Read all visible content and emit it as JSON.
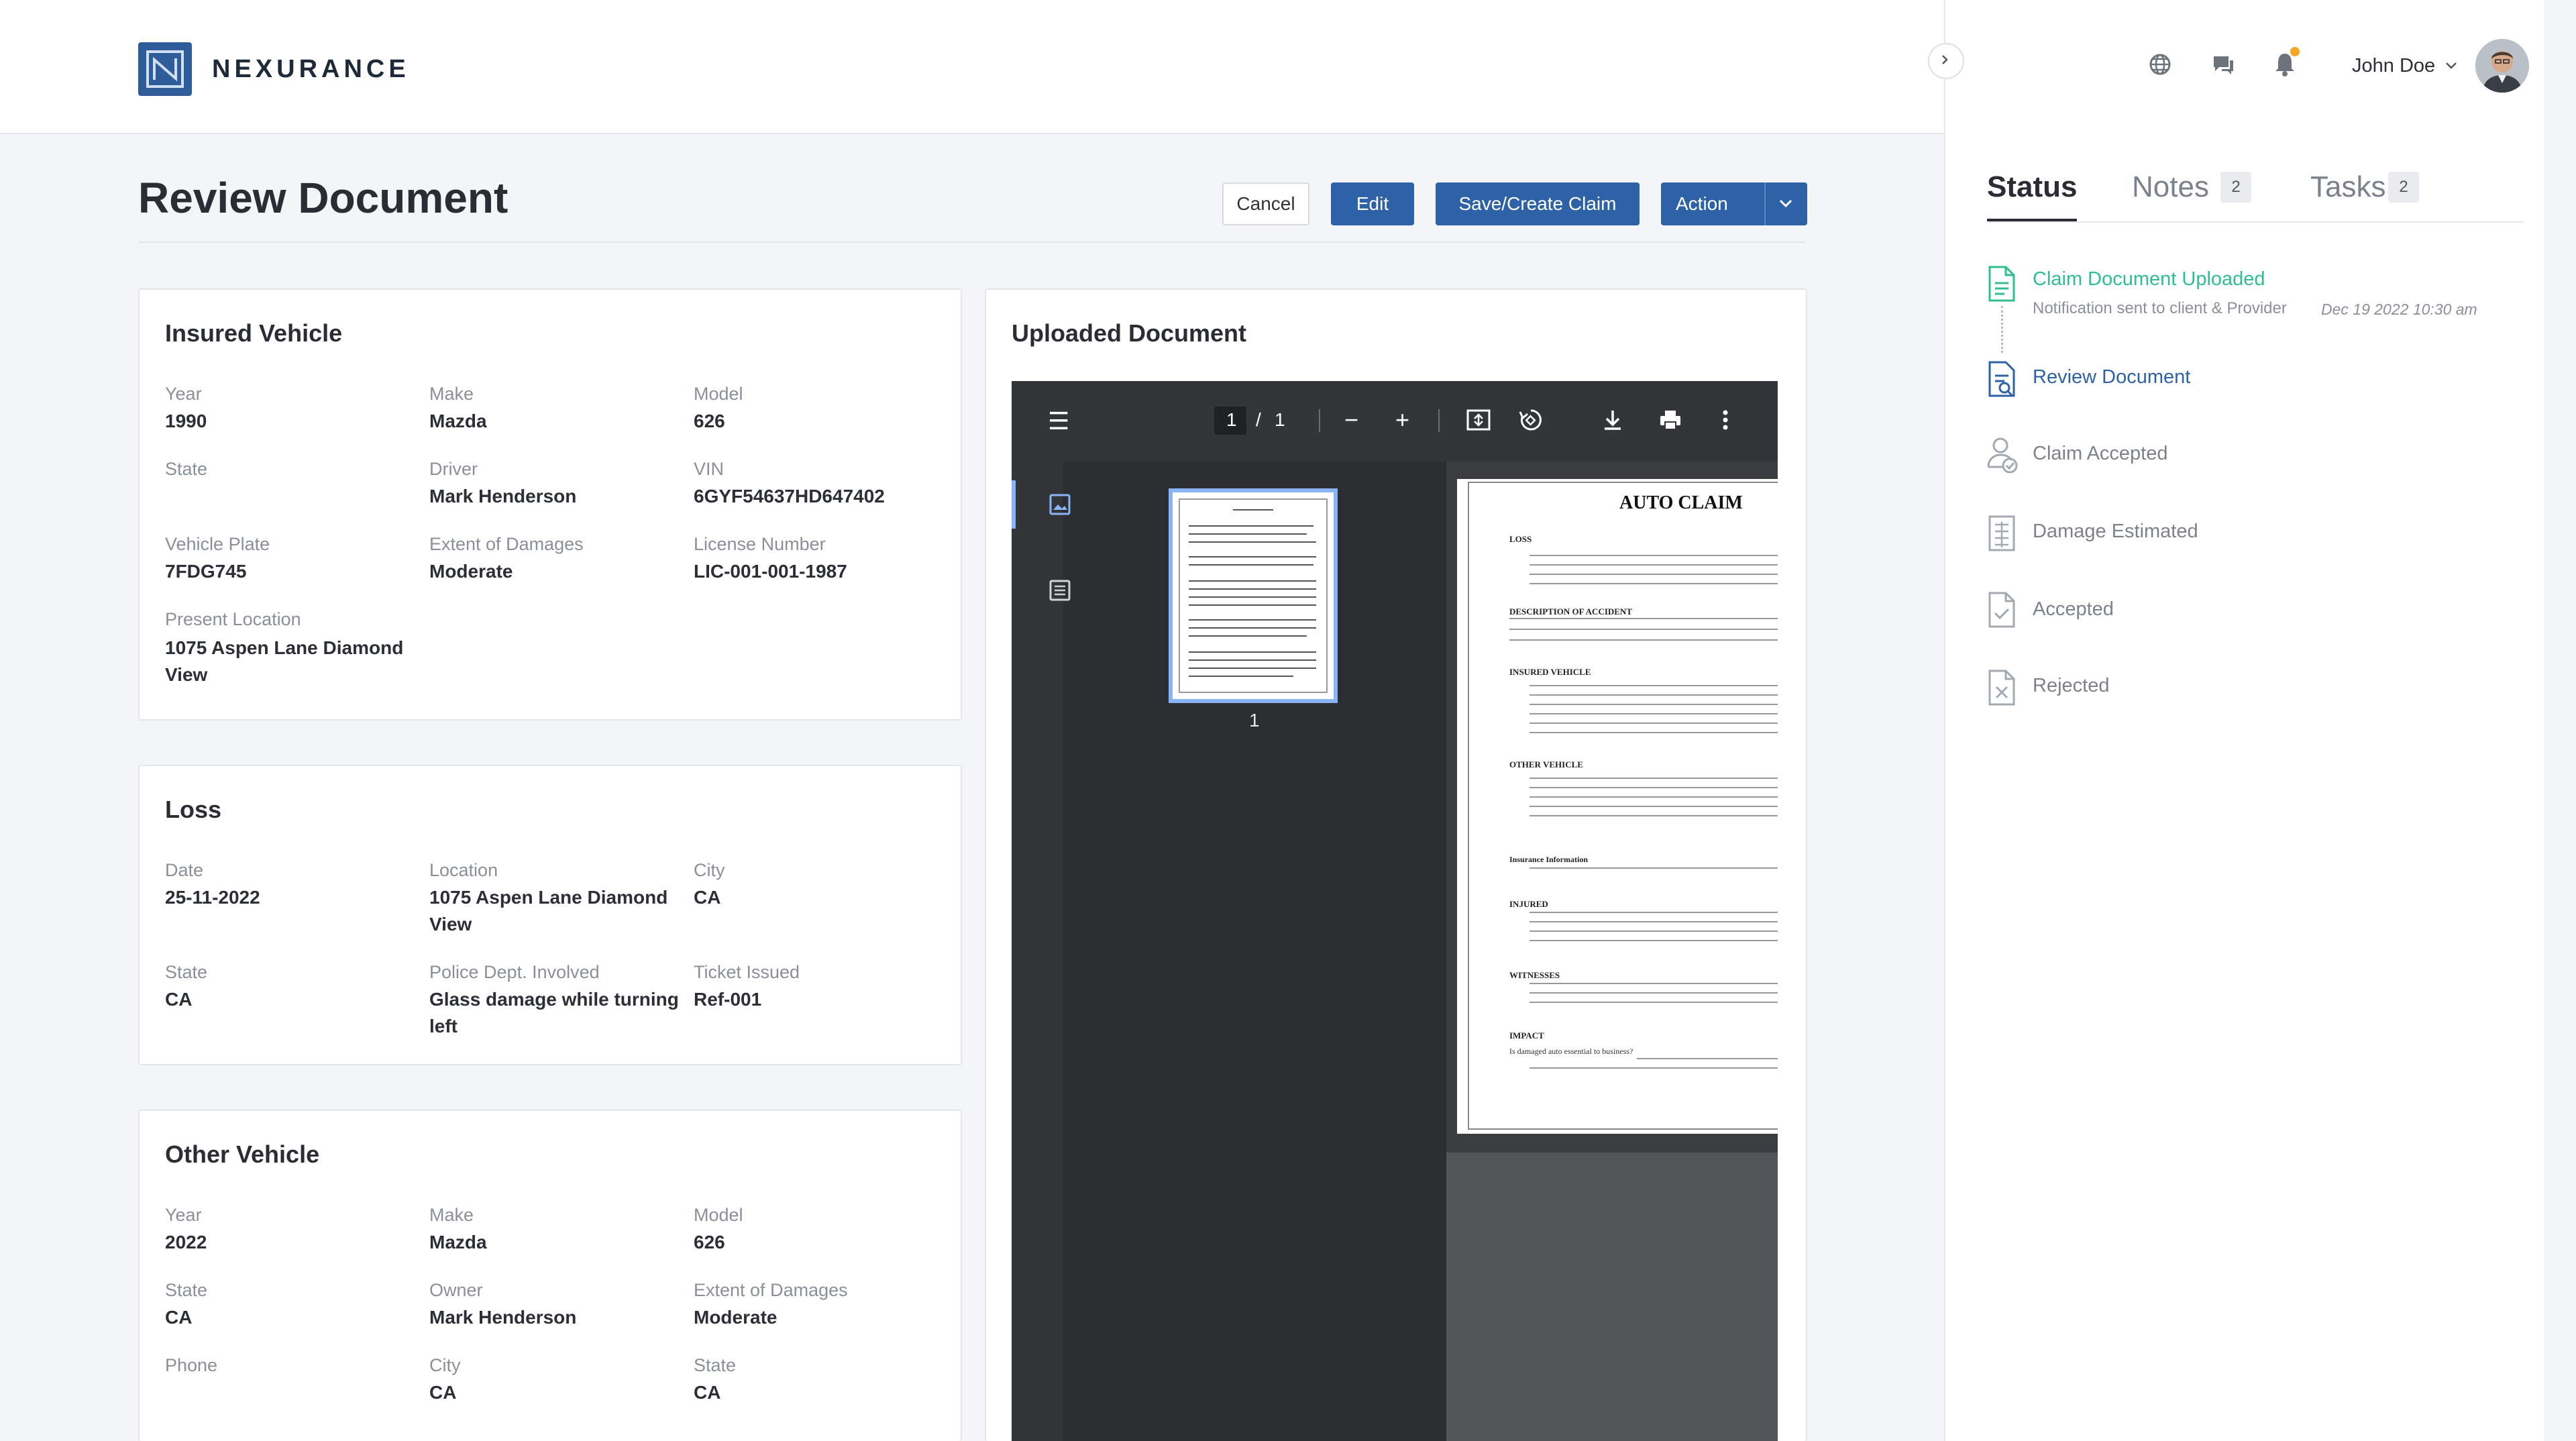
{
  "brand": {
    "name": "NEXURANCE",
    "color": "#2f5d9a"
  },
  "header": {
    "user_name": "John Doe",
    "icons": [
      "globe-icon",
      "chat-icon",
      "bell-icon",
      "chevron-down-icon"
    ],
    "notification_dot_color": "#f5a623"
  },
  "page": {
    "title": "Review Document",
    "buttons": {
      "cancel": "Cancel",
      "edit": "Edit",
      "save": "Save/Create Claim",
      "action": "Action"
    }
  },
  "insured_vehicle": {
    "title": "Insured Vehicle",
    "fields": {
      "year": {
        "label": "Year",
        "value": "1990"
      },
      "make": {
        "label": "Make",
        "value": "Mazda"
      },
      "model": {
        "label": "Model",
        "value": "626"
      },
      "state": {
        "label": "State",
        "value": ""
      },
      "driver": {
        "label": "Driver",
        "value": "Mark Henderson"
      },
      "vin": {
        "label": "VIN",
        "value": "6GYF54637HD647402"
      },
      "plate": {
        "label": "Vehicle Plate",
        "value": "7FDG745"
      },
      "damage": {
        "label": "Extent of Damages",
        "value": "Moderate"
      },
      "license": {
        "label": "License Number",
        "value": "LIC-001-001-1987"
      },
      "location": {
        "label": "Present Location",
        "value_line1": "1075 Aspen Lane Diamond",
        "value_line2": "View"
      }
    }
  },
  "loss": {
    "title": "Loss",
    "fields": {
      "date": {
        "label": "Date",
        "value": "25-11-2022"
      },
      "location": {
        "label": "Location",
        "value_line1": "1075 Aspen Lane Diamond",
        "value_line2": "View"
      },
      "city": {
        "label": "City",
        "value": "CA"
      },
      "state": {
        "label": "State",
        "value": "CA"
      },
      "police": {
        "label": "Police Dept. Involved",
        "value_line1": "Glass damage while turning",
        "value_line2": "left"
      },
      "ticket": {
        "label": "Ticket Issued",
        "value": "Ref-001"
      }
    }
  },
  "other_vehicle": {
    "title": "Other Vehicle",
    "fields": {
      "year": {
        "label": "Year",
        "value": "2022"
      },
      "make": {
        "label": "Make",
        "value": "Mazda"
      },
      "model": {
        "label": "Model",
        "value": "626"
      },
      "state": {
        "label": "State",
        "value": "CA"
      },
      "owner": {
        "label": "Owner",
        "value": "Mark Henderson"
      },
      "damage": {
        "label": "Extent of Damages",
        "value": "Moderate"
      },
      "phone": {
        "label": "Phone",
        "value": ""
      },
      "city": {
        "label": "City",
        "value": "CA"
      },
      "state2": {
        "label": "State",
        "value": "CA"
      }
    }
  },
  "document": {
    "title": "Uploaded Document",
    "viewer": {
      "page_current": "1",
      "page_separator": "/",
      "page_total": "1",
      "thumb_label": "1"
    },
    "pdf": {
      "heading": "AUTO CLAIM",
      "sections": [
        "LOSS",
        "DESCRIPTION OF ACCIDENT",
        "INSURED VEHICLE",
        "OTHER VEHICLE",
        "Insurance Information",
        "INJURED",
        "WITNESSES",
        "IMPACT"
      ],
      "impact_line": "Is damaged auto essential to business?"
    }
  },
  "sidebar": {
    "tabs": [
      {
        "label": "Status"
      },
      {
        "label": "Notes",
        "badge": "2"
      },
      {
        "label": "Tasks",
        "badge": "2"
      }
    ],
    "timeline": [
      {
        "label": "Claim Document Uploaded",
        "detail": "Notification sent to client & Provider",
        "timestamp": "Dec 19 2022 10:30 am",
        "state": "done",
        "color": "#2fbf8f"
      },
      {
        "label": "Review Document",
        "state": "current",
        "color": "#2e62a6"
      },
      {
        "label": "Claim Accepted",
        "state": "pending"
      },
      {
        "label": "Damage Estimated",
        "state": "pending"
      },
      {
        "label": "Accepted",
        "state": "pending"
      },
      {
        "label": "Rejected",
        "state": "pending"
      }
    ]
  }
}
